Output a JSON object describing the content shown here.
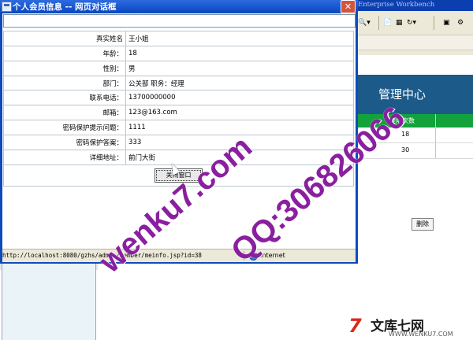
{
  "background_app": {
    "window_title": "Enterprise Workbench",
    "header_title": "管理中心",
    "table": {
      "column_header": "登陆次数",
      "rows": [
        "18",
        "30"
      ]
    },
    "delete_button": "删除"
  },
  "dialog": {
    "title": "个人会员信息 -- 网页对话框",
    "fields": [
      {
        "label": "真实姓名",
        "value": "王小姐"
      },
      {
        "label": "年龄：",
        "value": "18"
      },
      {
        "label": "性别：",
        "value": "男"
      },
      {
        "label": "部门：",
        "value": "公关部 职务：经理"
      },
      {
        "label": "联系电话：",
        "value": "13700000000"
      },
      {
        "label": "邮箱：",
        "value": "123@163.com"
      },
      {
        "label": "密码保护提示问题：",
        "value": "1111"
      },
      {
        "label": "密码保护答案：",
        "value": "333"
      },
      {
        "label": "详细地址：",
        "value": "前门大街"
      }
    ],
    "close_button": "关闭窗口",
    "statusbar": {
      "url": "http://localhost:8080/gzhs/admin/member/meinfo.jsp?id=38",
      "zone": "Internet"
    }
  },
  "watermarks": {
    "site": "wenku7.com",
    "qq": "QQ:306826066",
    "logo_text": "文库七网",
    "logo_url": "WWW.WENKU7.COM"
  },
  "colors": {
    "dialog_frame": "#0d4bbd",
    "header_bg": "#1c5a8a",
    "table_head": "#13a33c",
    "watermark": "#8a1fa0"
  }
}
